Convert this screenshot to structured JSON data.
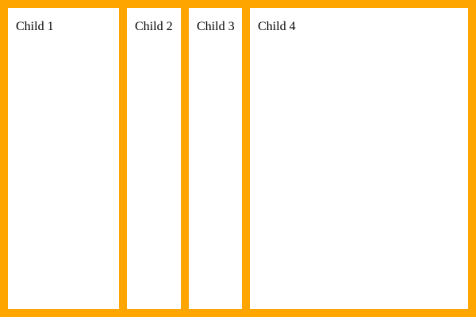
{
  "colors": {
    "background": "#ffa500",
    "panel": "#ffffff",
    "text": "#000000"
  },
  "children": [
    {
      "label": "Child 1"
    },
    {
      "label": "Child 2"
    },
    {
      "label": "Child 3"
    },
    {
      "label": "Child 4"
    }
  ]
}
